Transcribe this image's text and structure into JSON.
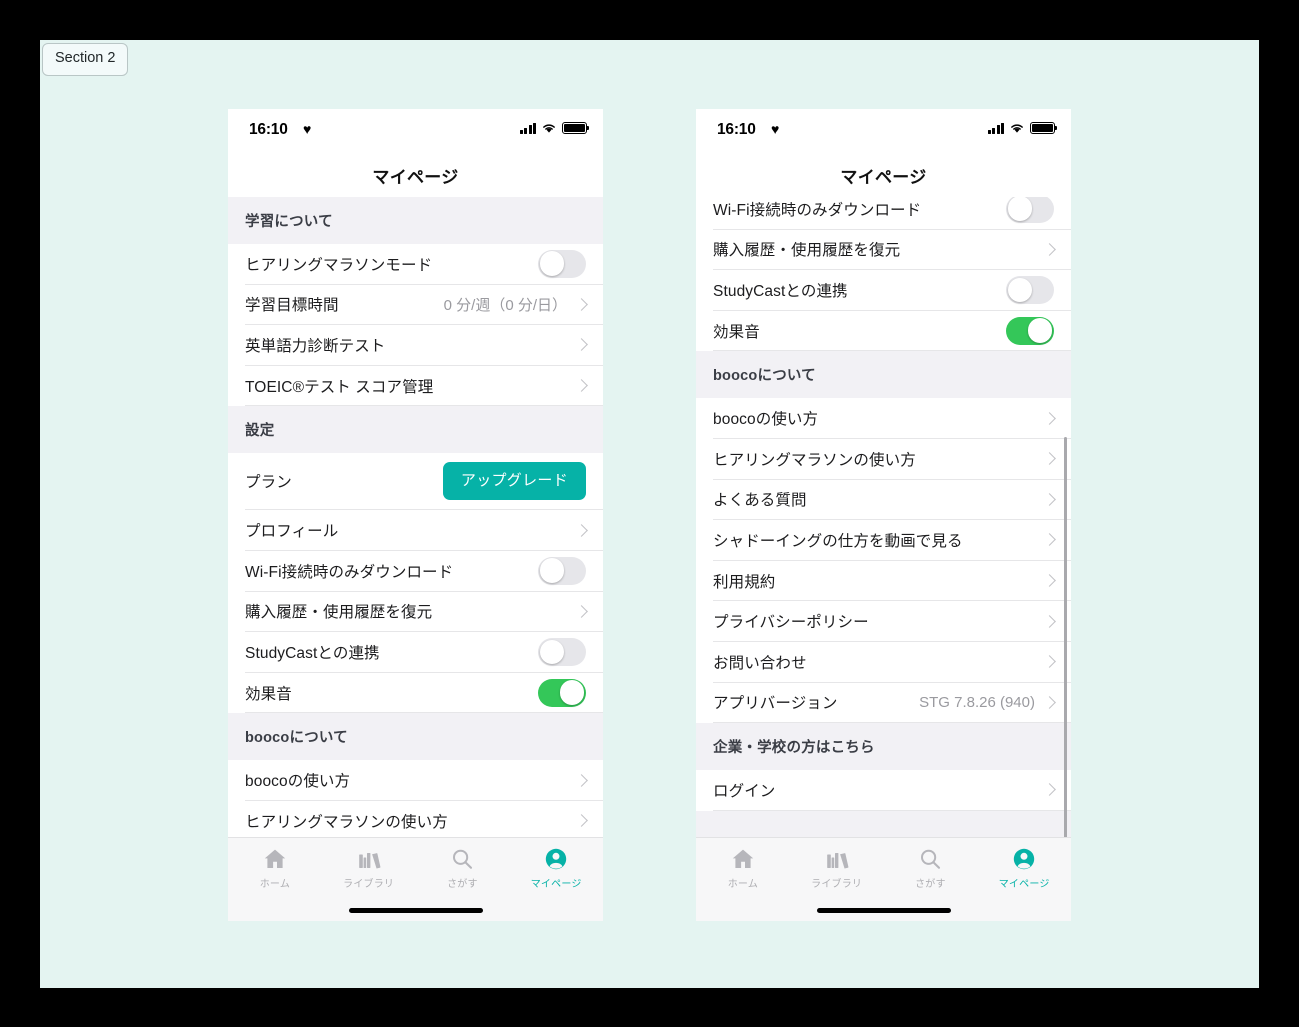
{
  "page": {
    "section_chip": "Section 2",
    "background_color": "#e4f4f1",
    "outer_color": "#000000",
    "accent_color": "#06b2a7",
    "toggle_on_color": "#34c759"
  },
  "status_bar": {
    "time": "16:10",
    "heart_icon": "heart-icon",
    "signal_icon": "cellular-signal-icon",
    "wifi_icon": "wifi-icon",
    "battery_icon": "battery-icon"
  },
  "nav": {
    "title": "マイページ"
  },
  "tabbar": {
    "tabs": [
      {
        "label": "ホーム",
        "icon": "home-icon",
        "active": false
      },
      {
        "label": "ライブラリ",
        "icon": "library-icon",
        "active": false
      },
      {
        "label": "さがす",
        "icon": "search-icon",
        "active": false
      },
      {
        "label": "マイページ",
        "icon": "person-icon",
        "active": true
      }
    ]
  },
  "left_phone": {
    "sections": [
      {
        "header": "学習について",
        "rows": [
          {
            "label": "ヒアリングマラソンモード",
            "type": "toggle",
            "on": false
          },
          {
            "label": "学習目標時間",
            "type": "value",
            "value": "0 分/週（0 分/日）"
          },
          {
            "label": "英単語力診断テスト",
            "type": "chevron"
          },
          {
            "label": "TOEIC®テスト スコア管理",
            "type": "chevron"
          }
        ]
      },
      {
        "header": "設定",
        "rows": [
          {
            "label": "プラン",
            "type": "button",
            "button_label": "アップグレード"
          },
          {
            "label": "プロフィール",
            "type": "chevron"
          },
          {
            "label": "Wi-Fi接続時のみダウンロード",
            "type": "toggle",
            "on": false
          },
          {
            "label": "購入履歴・使用履歴を復元",
            "type": "chevron"
          },
          {
            "label": "効果音",
            "type": "toggle",
            "on": true
          }
        ]
      },
      {
        "header": "boocoについて",
        "rows": [
          {
            "label": "boocoの使い方",
            "type": "chevron"
          },
          {
            "label": "ヒアリングマラソンの使い方",
            "type": "chevron"
          }
        ]
      }
    ],
    "studycast_row": {
      "label": "StudyCastとの連携",
      "type": "toggle",
      "on": false
    }
  },
  "right_phone": {
    "top_rows": [
      {
        "label": "Wi-Fi接続時のみダウンロード",
        "type": "toggle",
        "on": false
      },
      {
        "label": "購入履歴・使用履歴を復元",
        "type": "chevron"
      },
      {
        "label": "StudyCastとの連携",
        "type": "toggle",
        "on": false
      },
      {
        "label": "効果音",
        "type": "toggle",
        "on": true
      }
    ],
    "sections": [
      {
        "header": "boocoについて",
        "rows": [
          {
            "label": "boocoの使い方",
            "type": "chevron"
          },
          {
            "label": "ヒアリングマラソンの使い方",
            "type": "chevron"
          },
          {
            "label": "よくある質問",
            "type": "chevron"
          },
          {
            "label": "シャドーイングの仕方を動画で見る",
            "type": "chevron"
          },
          {
            "label": "利用規約",
            "type": "chevron"
          },
          {
            "label": "プライバシーポリシー",
            "type": "chevron"
          },
          {
            "label": "お問い合わせ",
            "type": "chevron"
          },
          {
            "label": "アプリバージョン",
            "type": "value",
            "value": "STG 7.8.26 (940)"
          }
        ]
      },
      {
        "header": "企業・学校の方はこちら",
        "rows": [
          {
            "label": "ログイン",
            "type": "chevron"
          }
        ]
      }
    ]
  }
}
